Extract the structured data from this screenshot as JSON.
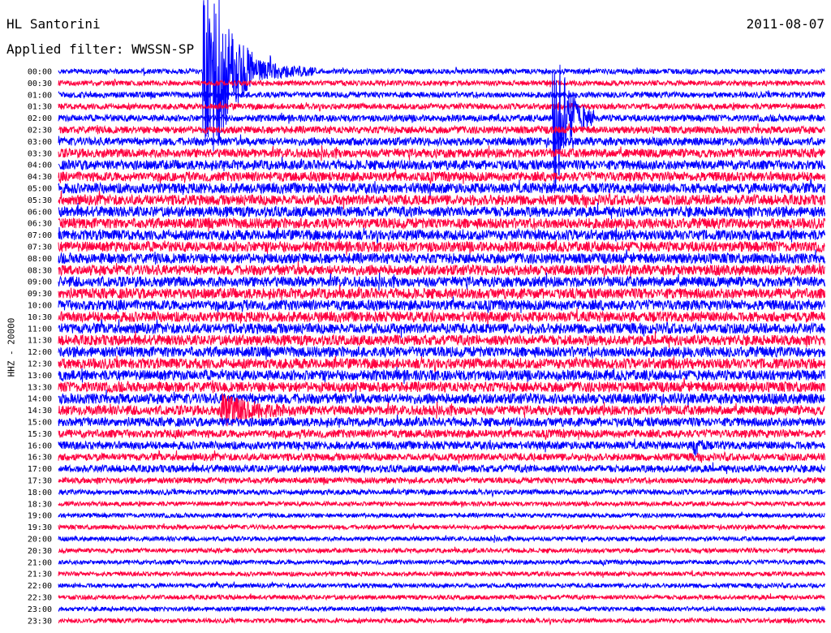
{
  "header": {
    "station": "HL Santorini",
    "filter": "Applied filter: WWSSN-SP",
    "date": "2011-08-07",
    "channel": "HHZ - 20000"
  },
  "colors": {
    "line_a": "#0000ff",
    "line_b": "#ff0040",
    "background": "#ffffff"
  },
  "chart_data": {
    "type": "helicorder",
    "title": "HL Santorini",
    "subtitle": "Applied filter: WWSSN-SP",
    "date": "2011-08-07",
    "ylabel": "HHZ - 20000",
    "minutes_per_line": 30,
    "y_tick_labels": [
      "00:00",
      "00:30",
      "01:00",
      "01:30",
      "02:00",
      "02:30",
      "03:00",
      "03:30",
      "04:00",
      "04:30",
      "05:00",
      "05:30",
      "06:00",
      "06:30",
      "07:00",
      "07:30",
      "08:00",
      "08:30",
      "09:00",
      "09:30",
      "10:00",
      "10:30",
      "11:00",
      "11:30",
      "12:00",
      "12:30",
      "13:00",
      "13:30",
      "14:00",
      "14:30",
      "15:00",
      "15:30",
      "16:00",
      "16:30",
      "17:00",
      "17:30",
      "18:00",
      "18:30",
      "19:00",
      "19:30",
      "20:00",
      "20:30",
      "21:00",
      "21:30",
      "22:00",
      "22:30",
      "23:00",
      "23:30"
    ],
    "series_colors": [
      "#0000ff",
      "#ff0040"
    ],
    "noise_amplitude": [
      0.35,
      0.35,
      0.4,
      0.4,
      0.45,
      0.5,
      0.55,
      0.6,
      0.65,
      0.65,
      0.7,
      0.7,
      0.7,
      0.7,
      0.7,
      0.7,
      0.7,
      0.7,
      0.7,
      0.7,
      0.7,
      0.7,
      0.7,
      0.7,
      0.7,
      0.7,
      0.7,
      0.7,
      0.7,
      0.65,
      0.6,
      0.55,
      0.55,
      0.5,
      0.5,
      0.4,
      0.35,
      0.3,
      0.3,
      0.3,
      0.3,
      0.3,
      0.3,
      0.3,
      0.3,
      0.3,
      0.3,
      0.3
    ],
    "events": [
      {
        "time": "00:00",
        "minute": 5.8,
        "amplitude": 12,
        "duration_min": 2.0
      },
      {
        "time": "00:00",
        "minute": 6.2,
        "amplitude": 4,
        "duration_min": 4.0
      },
      {
        "time": "02:00",
        "minute": 19.5,
        "amplitude": 10,
        "duration_min": 1.5
      },
      {
        "time": "14:30",
        "minute": 6.5,
        "amplitude": 2.0,
        "duration_min": 3.0
      },
      {
        "time": "16:00",
        "minute": 25.0,
        "amplitude": 1.0,
        "duration_min": 0.5
      }
    ]
  }
}
